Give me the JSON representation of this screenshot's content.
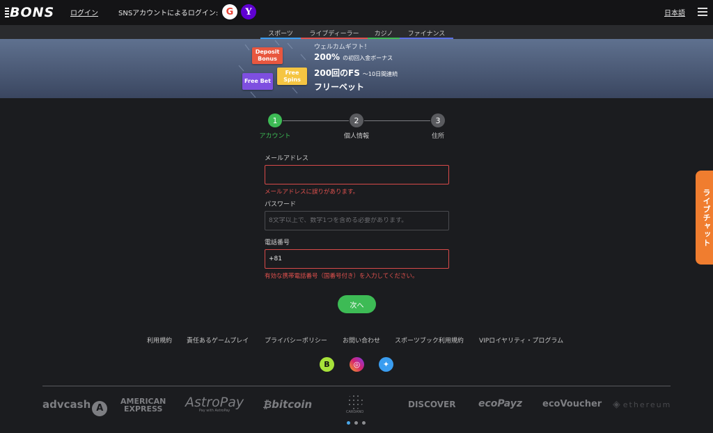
{
  "header": {
    "logo_text": "BONS",
    "login_label": "ログイン",
    "sns_label": "SNSアカウントによるログイン:",
    "google_glyph": "G",
    "yahoo_glyph": "Y",
    "language": "日本語"
  },
  "nav": {
    "tabs": [
      {
        "label": "スポーツ",
        "color": "#3a9df0"
      },
      {
        "label": "ライブディーラー",
        "color": "#e0514e"
      },
      {
        "label": "カジノ",
        "color": "#3dbb55"
      },
      {
        "label": "ファイナンス",
        "color": "#5b6fe6"
      }
    ]
  },
  "banner": {
    "badges": {
      "deposit": "Deposit Bonus",
      "freebet": "Free Bet",
      "freespins": "Free Spins"
    },
    "line1": "ウェルカムギフト！",
    "line2_big": "200%",
    "line2_small": "の初回入金ボーナス",
    "line3_big": "200回のFS",
    "line3_small": "〜10日間連続",
    "line4": "フリーベット"
  },
  "stepper": {
    "steps": [
      {
        "number": "1",
        "label": "アカウント"
      },
      {
        "number": "2",
        "label": "個人情報"
      },
      {
        "number": "3",
        "label": "住所"
      }
    ],
    "active_step": 1
  },
  "form": {
    "email": {
      "label": "メールアドレス",
      "value": "",
      "placeholder": "",
      "error": "メールアドレスに誤りがあります。"
    },
    "password": {
      "label": "パスワード",
      "value": "",
      "placeholder": "8文字以上で、数字1つを含める必要があります。"
    },
    "phone": {
      "label": "電話番号",
      "value": "+81",
      "error": "有効な携帯電話番号（国番号付き）を入力してください。"
    },
    "next_label": "次へ"
  },
  "footer": {
    "links": [
      "利用規約",
      "責任あるゲームプレイ",
      "プライバシーポリシー",
      "お問い合わせ",
      "スポーツブック利用規約",
      "VIPロイヤリティ・プログラム"
    ],
    "social": [
      {
        "name": "bons",
        "glyph": "B"
      },
      {
        "name": "instagram",
        "glyph": "◎"
      },
      {
        "name": "twitter",
        "glyph": "✦"
      }
    ],
    "payments": {
      "advcash": "advcash",
      "amex_line1": "AMERICAN",
      "amex_line2": "EXPRESS",
      "astropay": "AstroPay",
      "astropay_tag": "Pay with AstroPay",
      "bitcoin": "bitcoin",
      "cardano": "CARDANO",
      "discover": "DISCOVER",
      "ecopayz": "ecoPayz",
      "ecovoucher": "ecoVoucher",
      "ethereum": "ethereum"
    },
    "carousel_active": 1,
    "carousel_count": 3
  },
  "livechat": {
    "label": "ライブチャット",
    "color": "#f07d2f"
  },
  "colors": {
    "accent_green": "#3dbb55",
    "error_red": "#e0514e",
    "background": "#1b1c1f"
  }
}
